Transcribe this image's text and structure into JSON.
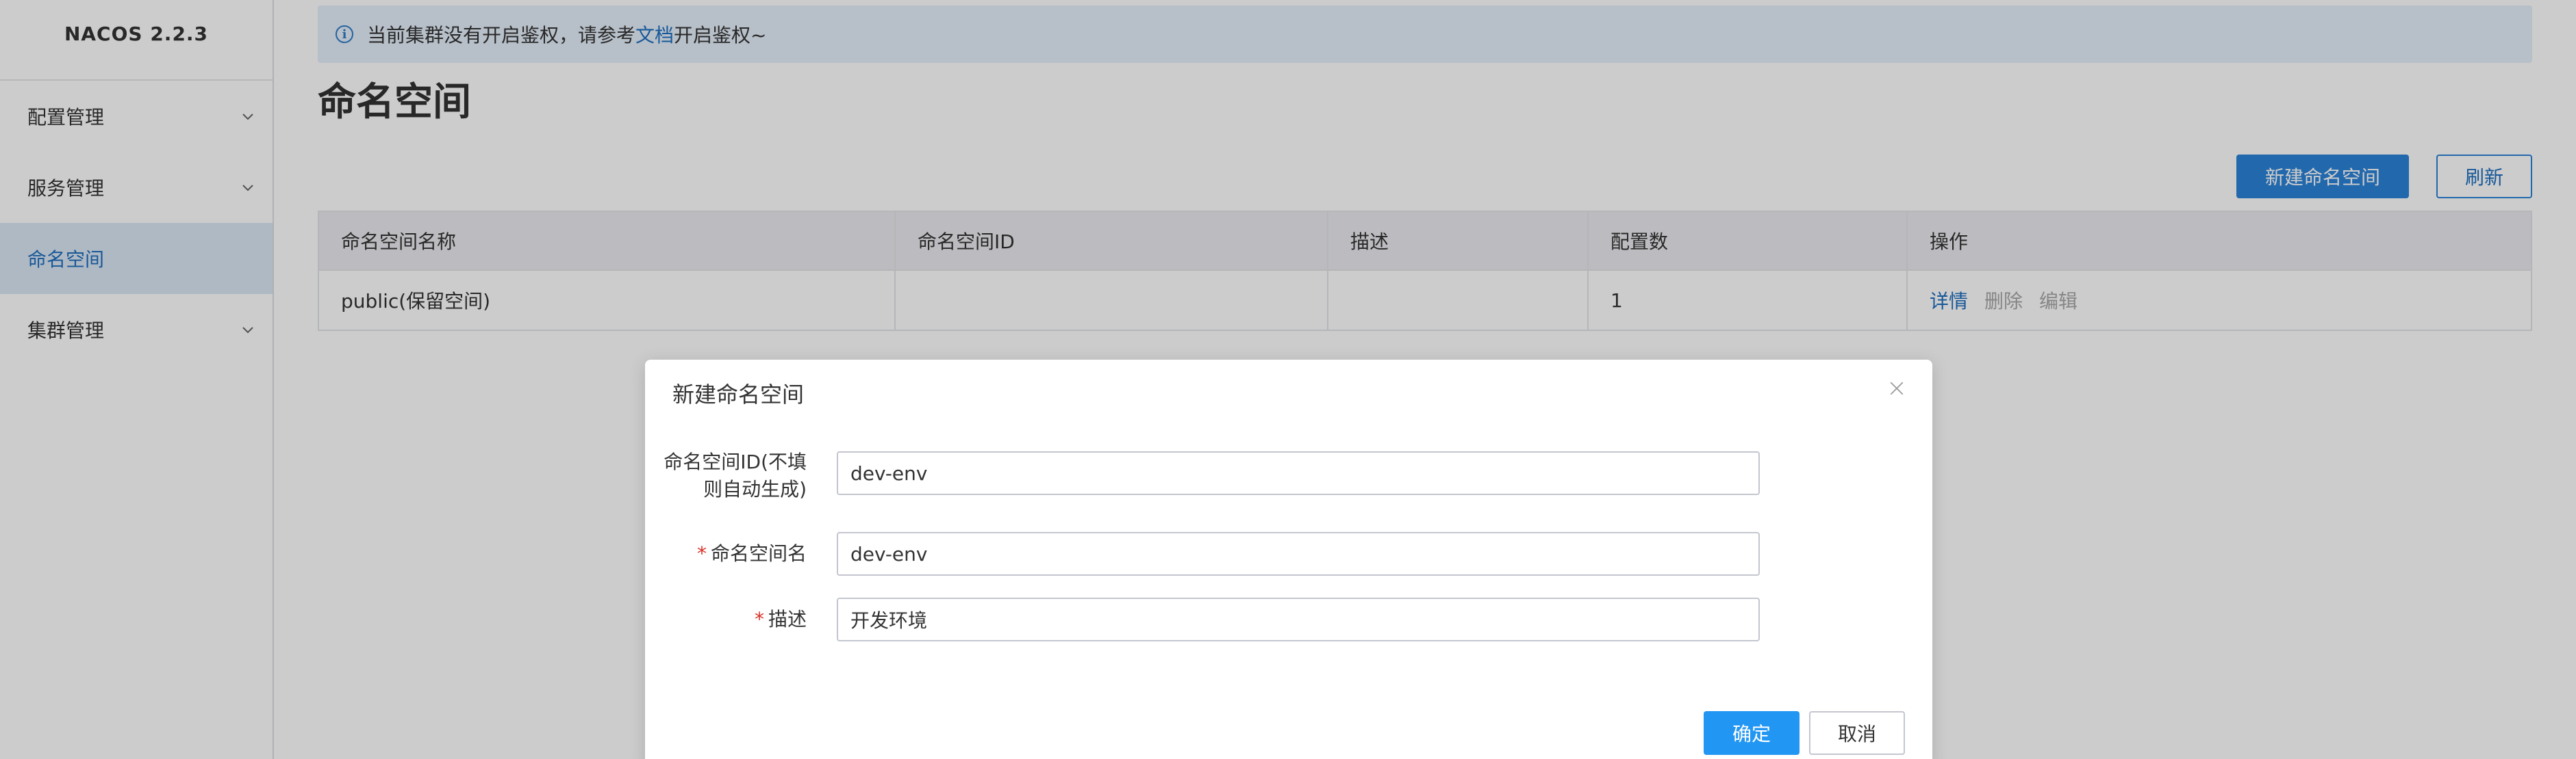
{
  "sidebar": {
    "logo": "NACOS 2.2.3",
    "items": [
      {
        "label": "配置管理",
        "icon": "chevron-down-icon"
      },
      {
        "label": "服务管理",
        "icon": "chevron-down-icon"
      },
      {
        "label": "命名空间",
        "active": true
      },
      {
        "label": "集群管理",
        "icon": "chevron-down-icon"
      }
    ]
  },
  "notice": {
    "text_before": "当前集群没有开启鉴权，请参考",
    "link": "文档",
    "text_after": "开启鉴权~",
    "icon": "info-icon"
  },
  "page": {
    "title": "命名空间",
    "new_button": "新建命名空间",
    "refresh_button": "刷新"
  },
  "table": {
    "columns": [
      "命名空间名称",
      "命名空间ID",
      "描述",
      "配置数",
      "操作"
    ],
    "rows": [
      {
        "name": "public(保留空间)",
        "id": "",
        "desc": "",
        "count": "1",
        "ops": {
          "detail": "详情",
          "delete": "删除",
          "edit": "编辑"
        }
      }
    ]
  },
  "dialog": {
    "title": "新建命名空间",
    "close_icon": "close-icon",
    "fields": {
      "id_label_line1": "命名空间ID(不填",
      "id_label_line2": "则自动生成)",
      "id_value": "dev-env",
      "name_label": "命名空间名",
      "name_value": "dev-env",
      "desc_label": "描述",
      "desc_value": "开发环境",
      "required_mark": "*"
    },
    "confirm": "确定",
    "cancel": "取消"
  },
  "colors": {
    "primary": "#2b83d8",
    "confirm": "#2196f3",
    "link": "#1d6fc0",
    "required": "#d93026",
    "notice_bg": "#e5effa"
  }
}
